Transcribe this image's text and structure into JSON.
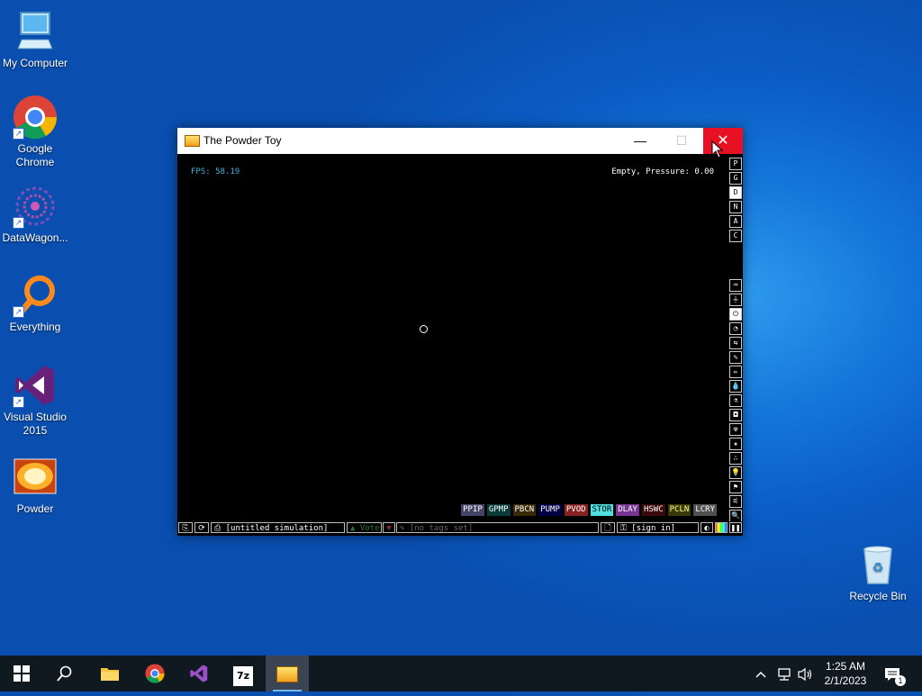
{
  "desktop": {
    "icons": [
      {
        "label": "My Computer"
      },
      {
        "label": "Google Chrome"
      },
      {
        "label": "DataWagon..."
      },
      {
        "label": "Everything"
      },
      {
        "label": "Visual Studio 2015"
      },
      {
        "label": "Powder"
      }
    ],
    "recycle_bin": "Recycle Bin"
  },
  "window": {
    "title": "The Powder Toy",
    "fps": "FPS: 58.19",
    "status": "Empty, Pressure: 0.00",
    "elements": [
      {
        "label": "PPIP",
        "bg": "#444466",
        "fg": "#ffffff"
      },
      {
        "label": "GPMP",
        "bg": "#0a3a3a",
        "fg": "#ffffff"
      },
      {
        "label": "PBCN",
        "bg": "#3a2a0a",
        "fg": "#ffffff"
      },
      {
        "label": "PUMP",
        "bg": "#000044",
        "fg": "#ffffff"
      },
      {
        "label": "PVOD",
        "bg": "#882222",
        "fg": "#ffffff"
      },
      {
        "label": "STOR",
        "bg": "#50dfdf",
        "fg": "#000000"
      },
      {
        "label": "DLAY",
        "bg": "#753590",
        "fg": "#ffffff"
      },
      {
        "label": "HSWC",
        "bg": "#3b0a0a",
        "fg": "#ffffff"
      },
      {
        "label": "PCLN",
        "bg": "#3b3b0a",
        "fg": "#ffff88"
      },
      {
        "label": "LCRY",
        "bg": "#505050",
        "fg": "#ffffff"
      }
    ],
    "sidebar_top": [
      {
        "label": "P",
        "selected": false
      },
      {
        "label": "G",
        "selected": false
      },
      {
        "label": "D",
        "selected": true
      },
      {
        "label": "N",
        "selected": false
      },
      {
        "label": "A",
        "selected": false
      },
      {
        "label": "C",
        "selected": false
      }
    ],
    "sidebar_tools": [
      "⌨",
      "⏚",
      "⏻",
      "◔",
      "⇆",
      "✎",
      "✏",
      "💧",
      "⚗",
      "◘",
      "☢",
      "★",
      "∴",
      "💡",
      "⚑",
      "⚟",
      "🔍"
    ],
    "bottom": {
      "sim_name": "[untitled simulation]",
      "vote": "Vote",
      "tags": "[no tags set]",
      "sign_in": "[sign in]"
    }
  },
  "taskbar": {
    "time": "1:25 AM",
    "date": "2/1/2023",
    "notifications": "1"
  },
  "colors": {
    "fps": "#3db3e0",
    "close_button": "#e81123",
    "taskbar": "#101820"
  }
}
